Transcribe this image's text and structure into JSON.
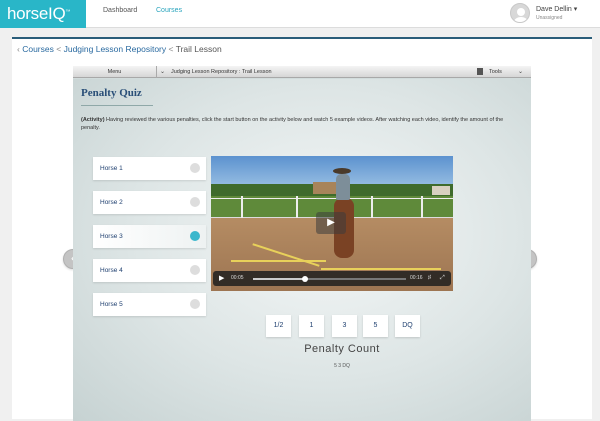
{
  "nav": {
    "logo": "horseIQ",
    "logo_tm": "™",
    "links": [
      "Dashboard",
      "Courses"
    ],
    "active": "Courses"
  },
  "user": {
    "name": "Dave Dellin ▾",
    "status": "Unassigned"
  },
  "breadcrumb": {
    "arrow": "‹",
    "items": [
      "Courses",
      "Judging Lesson Repository",
      "Trail Lesson"
    ],
    "separator": "<"
  },
  "player": {
    "menu_label": "Menu",
    "title": "Judging Lesson Repository : Trail Lesson",
    "tools_label": "Tools",
    "chevron": "⌄"
  },
  "quiz": {
    "title": "Penalty Quiz",
    "instructions_prefix": "(Activity)",
    "instructions": " Having reviewed the various penalties, click the start button on the activity below and watch 5 example videos. After watching each video, identify the amount of the penalty.",
    "horses": [
      {
        "label": "Horse 1",
        "selected": false
      },
      {
        "label": "Horse 2",
        "selected": false
      },
      {
        "label": "Horse 3",
        "selected": true
      },
      {
        "label": "Horse 4",
        "selected": false
      },
      {
        "label": "Horse 5",
        "selected": false
      }
    ]
  },
  "video": {
    "time_current": "00:05",
    "time_total": "00:16",
    "progress": 0.34,
    "play_icon": "▶"
  },
  "penalty": {
    "buttons": [
      "1/2",
      "1",
      "3",
      "5",
      "DQ"
    ],
    "count_label": "Penalty Count",
    "count_values": "5 3 DQ"
  },
  "arrows": {
    "prev": "‹",
    "next": "›"
  },
  "colors": {
    "brand": "#29b6c8",
    "link": "#2a6aa0",
    "selected_radio": "#3ab7cc"
  }
}
